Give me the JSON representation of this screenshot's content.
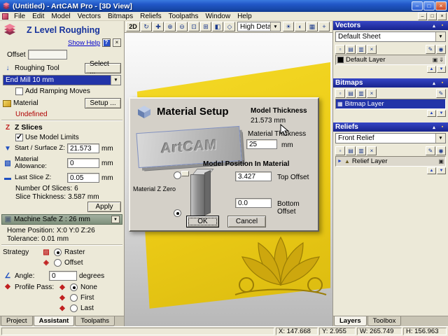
{
  "titlebar": {
    "title": "(Untitled) - ArtCAM Pro - [3D View]",
    "minimize": "–",
    "maximize": "□",
    "close": "×"
  },
  "menu": {
    "items": [
      "File",
      "Edit",
      "Model",
      "Vectors",
      "Bitmaps",
      "Reliefs",
      "Toolpaths",
      "Window",
      "Help"
    ],
    "child_minimize": "–",
    "child_restore": "□",
    "child_close": "×"
  },
  "assistant": {
    "title": "Z Level Roughing",
    "show_help": "Show Help",
    "help_button": "?",
    "close_button": "×",
    "offset_label": "Offset",
    "offset_value": "",
    "tool_label": "Roughing Tool",
    "tool_select": "Select ...",
    "tool_name": "End Mill 10 mm",
    "ramping": "Add Ramping Moves",
    "material_label": "Material",
    "material_setup": "Setup ...",
    "material_status": "Undefined",
    "zslices_title": "Z Slices",
    "use_model_limits": "Use Model Limits",
    "start_label": "Start / Surface Z:",
    "start_value": "21.573",
    "start_unit": "mm",
    "allow_label": "Material Allowance:",
    "allow_value": "0",
    "allow_unit": "mm",
    "last_label": "Last Slice Z:",
    "last_value": "0.05",
    "last_unit": "mm",
    "count_label": "Number Of Slices:",
    "count_value": "6",
    "thick_label": "Slice Thickness:",
    "thick_value": "3.587 mm",
    "apply": "Apply",
    "safez": "Machine Safe Z : 26 mm",
    "home_label": "Home Position:",
    "home_value": "X:0 Y:0 Z:26",
    "tol_label": "Tolerance:",
    "tol_value": "0.01 mm",
    "strategy_label": "Strategy",
    "strategy_raster": "Raster",
    "strategy_offset": "Offset",
    "angle_label": "Angle:",
    "angle_value": "0",
    "angle_unit": "degrees",
    "profile_label": "Profile Pass:",
    "profile_none": "None",
    "profile_first": "First",
    "profile_last": "Last",
    "tabs": [
      "Project",
      "Assistant",
      "Toolpaths"
    ],
    "active_tab": "Assistant",
    "icons": {
      "tool": "↓",
      "zslices": "Z",
      "start": "▼",
      "allow": "▧",
      "last": "▬",
      "machine": "▣",
      "raster": "▨",
      "offset": "◈",
      "angle": "∠",
      "diamond": "◆",
      "safez_arrow": "▼"
    }
  },
  "viewbar": {
    "btn_2d": "2D",
    "detail": "High Detail",
    "icons_pre": [
      {
        "name": "rotate-view-icon",
        "glyph": "↻"
      },
      {
        "name": "pan-view-icon",
        "glyph": "✚"
      },
      {
        "name": "zoom-in-icon",
        "glyph": "⊕"
      },
      {
        "name": "zoom-out-icon",
        "glyph": "⊖"
      },
      {
        "name": "zoom-window-icon",
        "glyph": "⊡"
      },
      {
        "name": "zoom-extents-icon",
        "glyph": "⊞"
      },
      {
        "name": "view-front-icon",
        "glyph": "◧"
      },
      {
        "name": "view-iso-icon",
        "glyph": "◇"
      }
    ],
    "icons_post": [
      {
        "name": "lighting-icon",
        "glyph": "☀"
      },
      {
        "name": "shading-icon",
        "glyph": "◐"
      },
      {
        "name": "wireframe-icon",
        "glyph": "▦"
      },
      {
        "name": "origin-icon",
        "glyph": "+"
      }
    ],
    "combo_arrow": "▼"
  },
  "dialog": {
    "title": "Material Setup",
    "model_thickness_label": "Model Thickness",
    "model_thickness_value": "21.573 mm",
    "material_thickness_label": "Material Thickness",
    "material_thickness_value": "25",
    "material_thickness_unit": "mm",
    "position_title": "Model Position In Material",
    "zzero_label": "Material Z Zero",
    "top_value": "3.427",
    "top_label": "Top Offset",
    "bottom_value": "0.0",
    "bottom_label": "Bottom Offset",
    "ok": "OK",
    "cancel": "Cancel",
    "preview_text": "ArtCAM"
  },
  "layers_panel": {
    "vectors_title": "Vectors",
    "vectors_combo": "Default Sheet",
    "vectors_layer": "Default Layer",
    "bitmaps_title": "Bitmaps",
    "bitmaps_layer": "Bitmap Layer",
    "reliefs_title": "Reliefs",
    "reliefs_combo": "Front Relief",
    "reliefs_layer": "Relief Layer",
    "tabs": [
      "Layers",
      "Toolbox"
    ],
    "active_tab": "Layers",
    "collapse": "▴",
    "pin": "▪",
    "tools": [
      {
        "name": "new-layer-icon",
        "glyph": "▫"
      },
      {
        "name": "load-layer-icon",
        "glyph": "▤"
      },
      {
        "name": "save-layer-icon",
        "glyph": "▥"
      },
      {
        "name": "delete-layer-icon",
        "glyph": "×"
      },
      {
        "name": "edit-layer-icon",
        "glyph": "✎"
      },
      {
        "name": "contour-layer-icon",
        "glyph": "◉"
      }
    ],
    "visibility_glyph": "▣",
    "merge_glyph": "⇓",
    "expand_glyph": "►",
    "bitmap_glyph": "▦",
    "relief_glyph": "▲",
    "arrow_up": "▲",
    "arrow_down": "▼",
    "combo_arrow": "▼"
  },
  "statusbar": {
    "x": "X: 147.668",
    "y": "Y: 2.955",
    "w": "W: 265.749",
    "h": "H: 156.963"
  },
  "colors": {
    "header_navy": "#18248e",
    "selection_blue": "#2234a8",
    "material_yellow": "#eccb16",
    "relief_gold": "#b89608",
    "undefined_red": "#b00000"
  }
}
